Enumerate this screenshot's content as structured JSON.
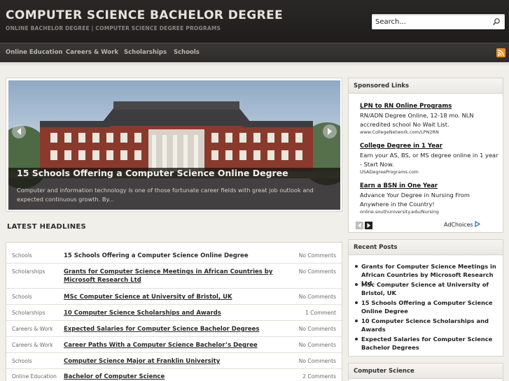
{
  "header": {
    "site_title": "COMPUTER SCIENCE BACHELOR DEGREE",
    "tagline": "ONLINE BACHELOR DEGREE | COMPUTER SCIENCE DEGREE PROGRAMS",
    "search_placeholder": "Search..."
  },
  "nav": {
    "items": [
      "Online Education",
      "Careers & Work",
      "Scholarships",
      "Schools"
    ]
  },
  "slider": {
    "title": "15 Schools Offering a Computer Science Online Degree",
    "excerpt": "Computer and information technology is one of those fortunate career fields with great job outlook and expected continuous growth. By..."
  },
  "headlines": {
    "section_title": "LATEST HEADLINES",
    "rows": [
      {
        "category": "Schools",
        "title": "15 Schools Offering a Computer Science Online Degree",
        "comments": "No Comments"
      },
      {
        "category": "Scholarships",
        "title": "Grants for Computer Science Meetings in African Countries by Microsoft Research Ltd",
        "comments": "No Comments"
      },
      {
        "category": "Schools",
        "title": "MSc Computer Science at University of Bristol, UK",
        "comments": "No Comments"
      },
      {
        "category": "Scholarships",
        "title": "10 Computer Science Scholarships and Awards",
        "comments": "1 Comment"
      },
      {
        "category": "Careers & Work",
        "title": "Expected Salaries for Computer Science Bachelor Degrees",
        "comments": "No Comments"
      },
      {
        "category": "Careers & Work",
        "title": "Career Paths With a Computer Science Bachelor’s Degree",
        "comments": "No Comments"
      },
      {
        "category": "Schools",
        "title": "Computer Science Major at Franklin University",
        "comments": "No Comments"
      },
      {
        "category": "Online Education",
        "title": "Bachelor of Computer Science",
        "comments": "2 Comments"
      }
    ]
  },
  "sponsored": {
    "title": "Sponsored Links",
    "ads": [
      {
        "title": "LPN to RN Online Programs",
        "desc": "RN/ADN Degree Online, 12-18 mo. NLN accredited school No Wait List.",
        "url": "www.CollegeNetwork.com/LPN2RN"
      },
      {
        "title": "College Degree in 1 Year",
        "desc": "Earn your AS, BS, or MS degree online in 1 year - Start Now.",
        "url": "USADegreePrograms.com"
      },
      {
        "title": "Earn a BSN in One Year",
        "desc": "Advance Your Degree in Nursing From Anywhere in the Country!",
        "url": "online.southuniversity.edu/Nursing"
      }
    ],
    "adchoices": "AdChoices"
  },
  "recent_posts": {
    "title": "Recent Posts",
    "items": [
      "Grants for Computer Science Meetings in African Countries by Microsoft Research Ltd",
      "MSc Computer Science at University of Bristol, UK",
      "15 Schools Offering a Computer Science Online Degree",
      "10 Computer Science Scholarships and Awards",
      "Expected Salaries for Computer Science Bachelor Degrees"
    ]
  },
  "computer_science_widget": {
    "title": "Computer Science"
  },
  "colors": {
    "header_bg": "#1f1d1c",
    "nav_bg": "#2d2b29",
    "page_bg": "#f1efe9",
    "rss": "#f08a1c"
  }
}
